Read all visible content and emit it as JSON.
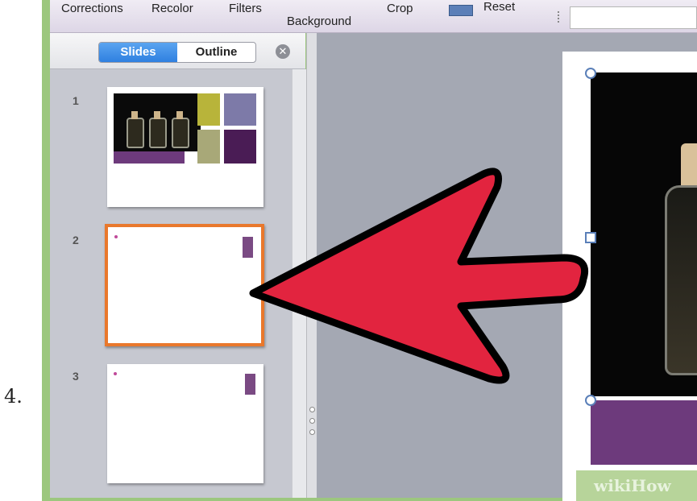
{
  "step_label": "4.",
  "ribbon": {
    "items": [
      "Corrections",
      "Recolor",
      "Filters",
      "Background",
      "Crop",
      "Reset"
    ]
  },
  "panel": {
    "tabs": [
      {
        "label": "Slides",
        "selected": true
      },
      {
        "label": "Outline",
        "selected": false
      }
    ],
    "close_icon": "close-icon"
  },
  "slides": [
    {
      "number": "1",
      "selected": false
    },
    {
      "number": "2",
      "selected": true
    },
    {
      "number": "3",
      "selected": false
    }
  ],
  "watermark": "wikiHow",
  "colors": {
    "arrow_fill": "#e2243f",
    "selection_border": "#e9782c",
    "accent_purple": "#6d3a7c",
    "frame_green": "#9cc77e",
    "segment_blue": "#2f80e0"
  }
}
